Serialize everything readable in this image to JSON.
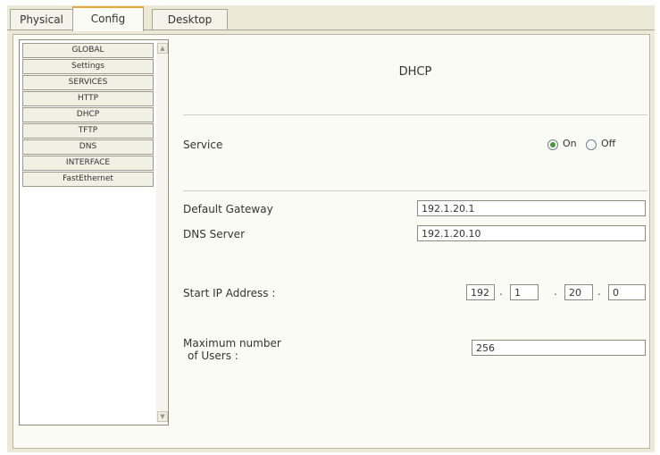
{
  "tabs": [
    {
      "label": "Physical"
    },
    {
      "label": "Config"
    },
    {
      "label": "Desktop"
    }
  ],
  "active_tab": "Config",
  "sidebar": {
    "items": [
      {
        "label": "GLOBAL"
      },
      {
        "label": "Settings"
      },
      {
        "label": "SERVICES"
      },
      {
        "label": "HTTP"
      },
      {
        "label": "DHCP"
      },
      {
        "label": "TFTP"
      },
      {
        "label": "DNS"
      },
      {
        "label": "INTERFACE"
      },
      {
        "label": "FastEthernet"
      }
    ],
    "selected": "DHCP"
  },
  "main": {
    "title": "DHCP",
    "service": {
      "label": "Service",
      "on_label": "On",
      "off_label": "Off",
      "selected": "On"
    },
    "default_gateway": {
      "label": "Default Gateway",
      "value": "192.1.20.1"
    },
    "dns_server": {
      "label": "DNS Server",
      "value": "192.1.20.10"
    },
    "start_ip": {
      "label": "Start IP Address :",
      "octets": [
        "192",
        "1",
        "20",
        "0"
      ],
      "separator": "."
    },
    "max_users": {
      "label_line1": "Maximum number",
      "label_line2": "of Users :",
      "value": "256"
    }
  },
  "colors": {
    "window_bg": "#ece9d8",
    "panel_bg": "#fbfbf6",
    "active_tab_accent": "#e3a83a",
    "radio_selected": "#4a9a3a"
  }
}
